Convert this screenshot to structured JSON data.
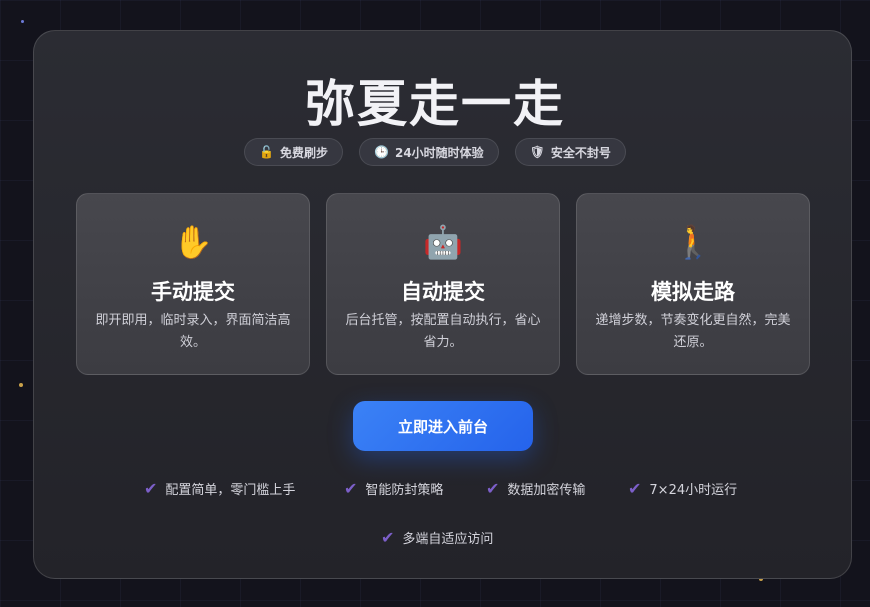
{
  "title": "弥夏走一走",
  "badges": [
    {
      "icon": "🔓",
      "label": "免费刷步"
    },
    {
      "icon": "🕒",
      "label": "24小时随时体验"
    },
    {
      "icon": "🛡",
      "label": "安全不封号"
    }
  ],
  "cards": [
    {
      "icon": "✋",
      "title": "手动提交",
      "desc": "即开即用，临时录入，界面简洁高效。"
    },
    {
      "icon": "🤖",
      "title": "自动提交",
      "desc": "后台托管，按配置自动执行，省心省力。"
    },
    {
      "icon": "🚶",
      "title": "模拟走路",
      "desc": "递增步数，节奏变化更自然，完美还原。"
    }
  ],
  "cta_label": "立即进入前台",
  "check_icon": "✔",
  "features": [
    "配置简单，零门槛上手",
    "智能防封策略",
    "数据加密传输",
    "7×24小时运行",
    "多端自适应访问"
  ],
  "colors": {
    "accent": "#2563eb",
    "check": "#7c5fc9"
  }
}
